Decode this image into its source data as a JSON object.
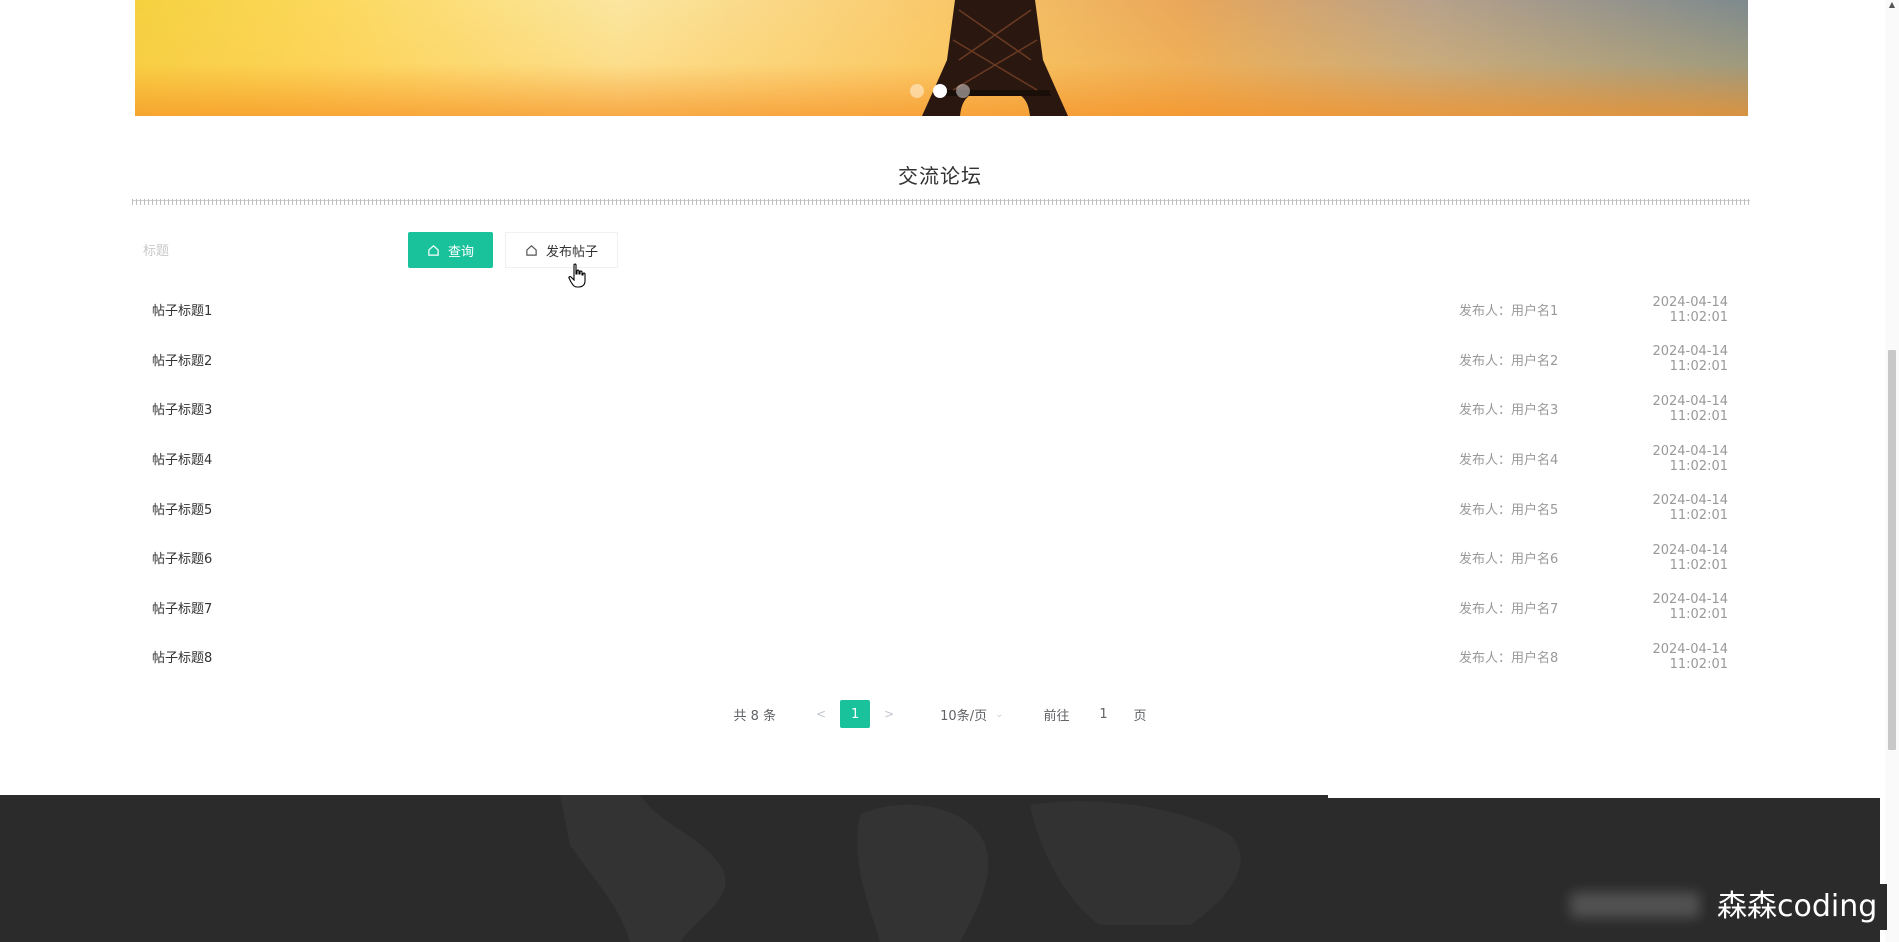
{
  "forum": {
    "title": "交流论坛"
  },
  "search": {
    "placeholder": "标题",
    "query_label": "查询",
    "post_label": "发布帖子"
  },
  "posts": [
    {
      "title": "帖子标题1",
      "author": "发布人：用户名1",
      "time": "2024-04-14 11:02:01"
    },
    {
      "title": "帖子标题2",
      "author": "发布人：用户名2",
      "time": "2024-04-14 11:02:01"
    },
    {
      "title": "帖子标题3",
      "author": "发布人：用户名3",
      "time": "2024-04-14 11:02:01"
    },
    {
      "title": "帖子标题4",
      "author": "发布人：用户名4",
      "time": "2024-04-14 11:02:01"
    },
    {
      "title": "帖子标题5",
      "author": "发布人：用户名5",
      "time": "2024-04-14 11:02:01"
    },
    {
      "title": "帖子标题6",
      "author": "发布人：用户名6",
      "time": "2024-04-14 11:02:01"
    },
    {
      "title": "帖子标题7",
      "author": "发布人：用户名7",
      "time": "2024-04-14 11:02:01"
    },
    {
      "title": "帖子标题8",
      "author": "发布人：用户名8",
      "time": "2024-04-14 11:02:01"
    }
  ],
  "pagination": {
    "total": "共 8 条",
    "prev": "<",
    "current": "1",
    "next": ">",
    "page_size": "10条/页",
    "goto": "前往",
    "goto_value": "1",
    "page_suffix": "页"
  },
  "watermark": "森森coding",
  "colors": {
    "accent": "#19c29b",
    "footer": "#2b2b2b"
  },
  "icons": {
    "query": "home-icon",
    "post": "home-icon",
    "carousel": "carousel-dots"
  }
}
